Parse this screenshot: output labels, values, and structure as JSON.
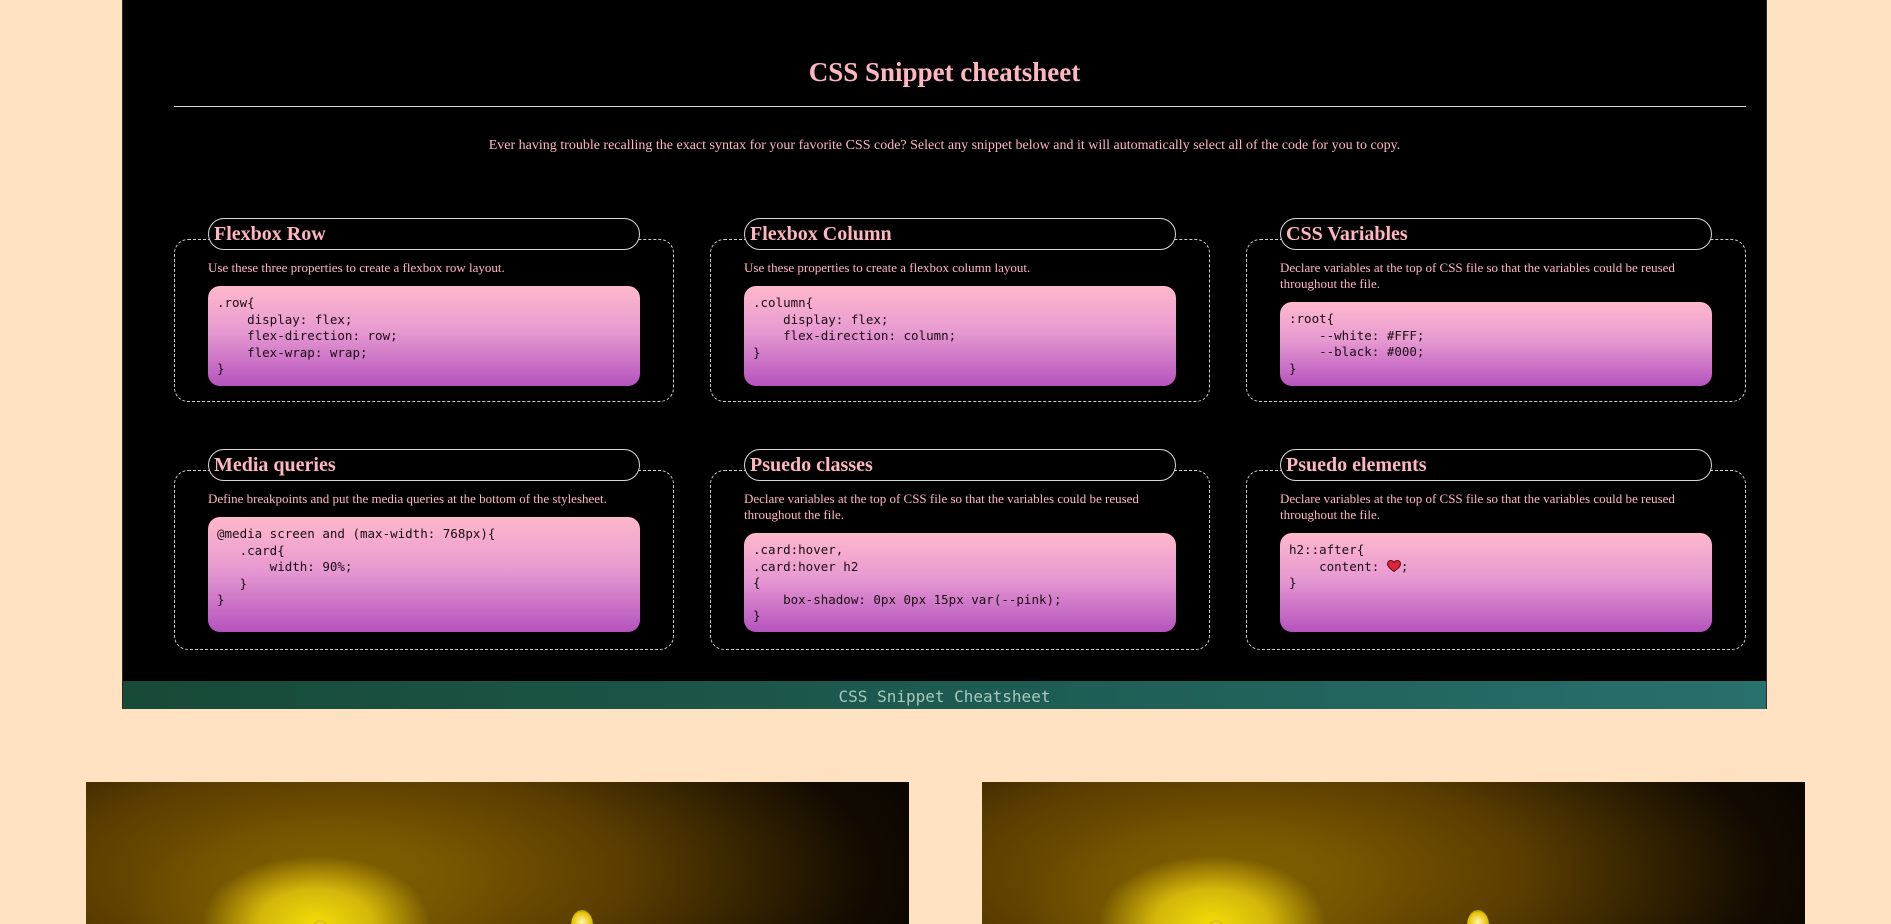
{
  "page": {
    "title": "CSS Snippet cheatsheet",
    "intro": "Ever having trouble recalling the exact syntax for your favorite CSS code? Select any snippet below and it will automatically select all of the code for you to copy."
  },
  "cards": [
    {
      "title": "Flexbox Row",
      "description": "Use these three properties to create a flexbox row layout.",
      "code": ".row{\n    display: flex;\n    flex-direction: row;\n    flex-wrap: wrap;\n}"
    },
    {
      "title": "Flexbox Column",
      "description": "Use these properties to create a flexbox column layout.",
      "code": ".column{\n    display: flex;\n    flex-direction: column;\n}"
    },
    {
      "title": "CSS Variables",
      "description": "Declare variables at the top of CSS file so that the variables could be reused throughout the file.",
      "code": ":root{\n    --white: #FFF;\n    --black: #000;\n}"
    },
    {
      "title": "Media queries",
      "description": "Define breakpoints and put the media queries at the bottom of the stylesheet.",
      "code": "@media screen and (max-width: 768px){\n   .card{\n       width: 90%;\n   }\n}"
    },
    {
      "title": "Psuedo classes",
      "description": "Declare variables at the top of CSS file so that the variables could be reused throughout the file.",
      "code": ".card:hover,\n.card:hover h2\n{\n    box-shadow: 0px 0px 15px var(--pink);\n}"
    },
    {
      "title": "Psuedo elements",
      "description": "Declare variables at the top of CSS file so that the variables could be reused throughout the file.",
      "code_before": "h2::after{\n    content: ",
      "code_icon": "heart-emoji-icon",
      "code_after": ";\n}"
    }
  ],
  "footer": {
    "text": "CSS Snippet Cheatsheet"
  },
  "colors": {
    "page_background": "#ffe2c2",
    "sheet_background": "#000000",
    "heading_pink": "#ffb6c1",
    "snippet_gradient_top": "#ffb8cc",
    "snippet_gradient_bottom": "#b553be",
    "footer_green": "#1d5a50"
  },
  "images": [
    {
      "name": "fireworks-photo-left"
    },
    {
      "name": "fireworks-photo-right"
    }
  ]
}
